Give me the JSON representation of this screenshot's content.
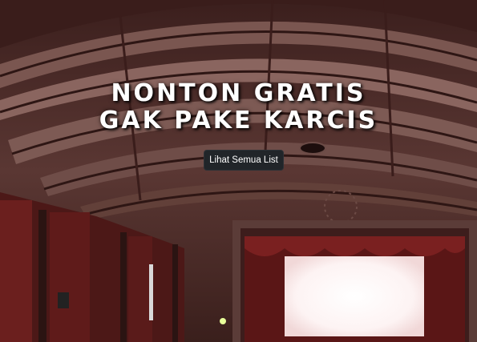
{
  "hero": {
    "title_line1": "NONTON GRATIS",
    "title_line2": "GAK PAKE KARCIS",
    "cta_label": "Lihat Semua List"
  },
  "colors": {
    "button_bg": "#212529",
    "title_text": "#ffffff",
    "ceiling": "#6e4a45",
    "screen": "#ffffff"
  }
}
